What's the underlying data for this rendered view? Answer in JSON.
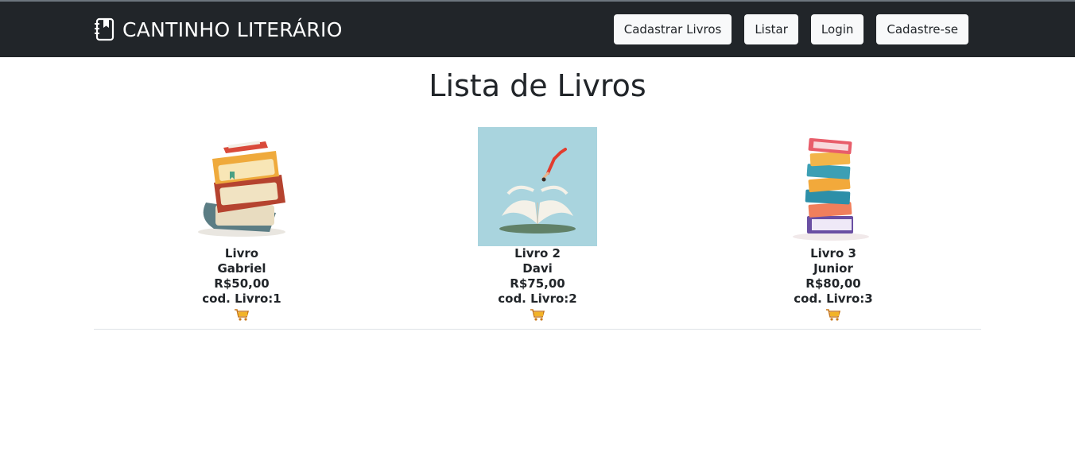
{
  "brand": {
    "title": "CANTINHO LITERÁRIO",
    "icon": "journal-bookmark-icon"
  },
  "nav": {
    "items": [
      {
        "label": "Cadastrar Livros"
      },
      {
        "label": "Listar"
      },
      {
        "label": "Login"
      },
      {
        "label": "Cadastre-se"
      }
    ]
  },
  "page": {
    "title": "Lista de Livros"
  },
  "books": [
    {
      "title": "Livro",
      "author": "Gabriel",
      "price": "R$50,00",
      "code": "cod. Livro:1",
      "cover": "stacked-books-illustration",
      "cart_icon": "cart-icon"
    },
    {
      "title": "Livro 2",
      "author": "Davi",
      "price": "R$75,00",
      "code": "cod. Livro:2",
      "cover": "diver-open-book-illustration",
      "cart_icon": "cart-icon"
    },
    {
      "title": "Livro 3",
      "author": "Junior",
      "price": "R$80,00",
      "code": "cod. Livro:3",
      "cover": "colorful-book-stack-illustration",
      "cart_icon": "cart-icon"
    }
  ],
  "colors": {
    "navbar": "#212529",
    "button_bg": "#f8f9fa",
    "text": "#212529",
    "cart": "#e8a317"
  }
}
